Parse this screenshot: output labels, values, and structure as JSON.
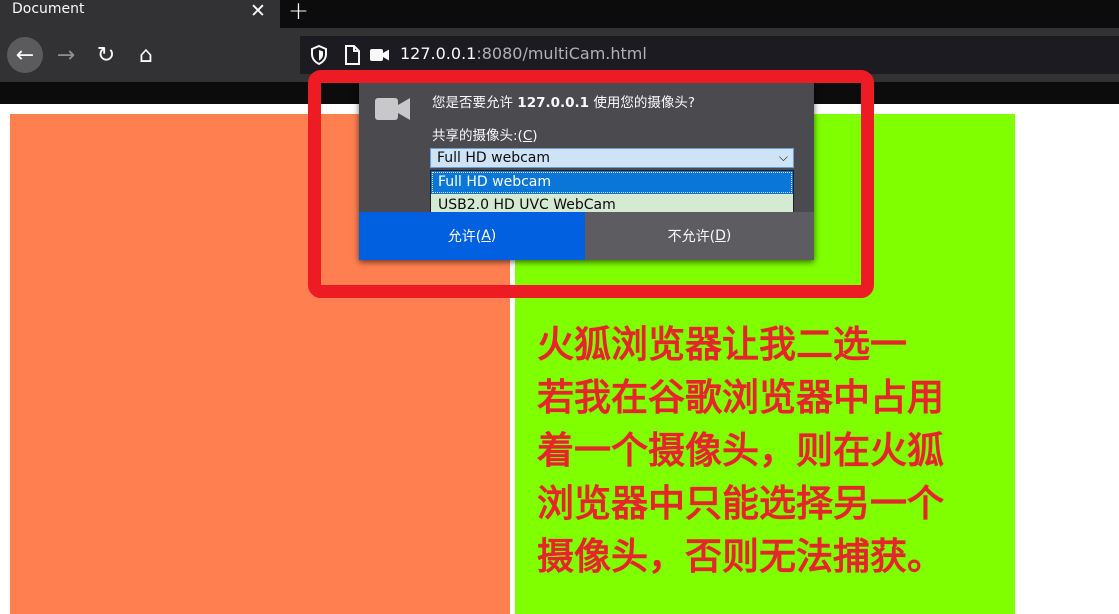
{
  "tab": {
    "title": "Document",
    "close": "✕",
    "new_tab": "+"
  },
  "nav": {
    "back": "←",
    "forward": "→",
    "reload": "↻",
    "home": "⌂"
  },
  "url": {
    "host": "127.0.0.1",
    "rest": ":8080/multiCam.html"
  },
  "icons": [
    "shield-icon",
    "page-icon",
    "camera-icon"
  ],
  "popup": {
    "question_prefix": "您是否要允许 ",
    "question_host": "127.0.0.1",
    "question_suffix": " 使用您的摄像头?",
    "share_label": "共享的摄像头:(",
    "share_key": "C",
    "share_end": ")",
    "selected_camera": "Full HD webcam",
    "options": [
      "Full HD webcam",
      "USB2.0 HD UVC WebCam"
    ],
    "allow_label": "允许(",
    "allow_key": "A",
    "deny_label": "不允许(",
    "deny_key": "D",
    "close_paren": ")"
  },
  "annotation": {
    "lines": [
      "火狐浏览器让我二选一",
      "若我在谷歌浏览器中占用",
      "着一个摄像头，则在火狐",
      "浏览器中只能选择另一个",
      "摄像头，否则无法捕获。"
    ],
    "color": "#e5242b"
  },
  "colors": {
    "left_box": "#ff7f50",
    "right_box": "#7fff00",
    "highlight": "#ed1c24",
    "allow_button": "#0060df"
  }
}
